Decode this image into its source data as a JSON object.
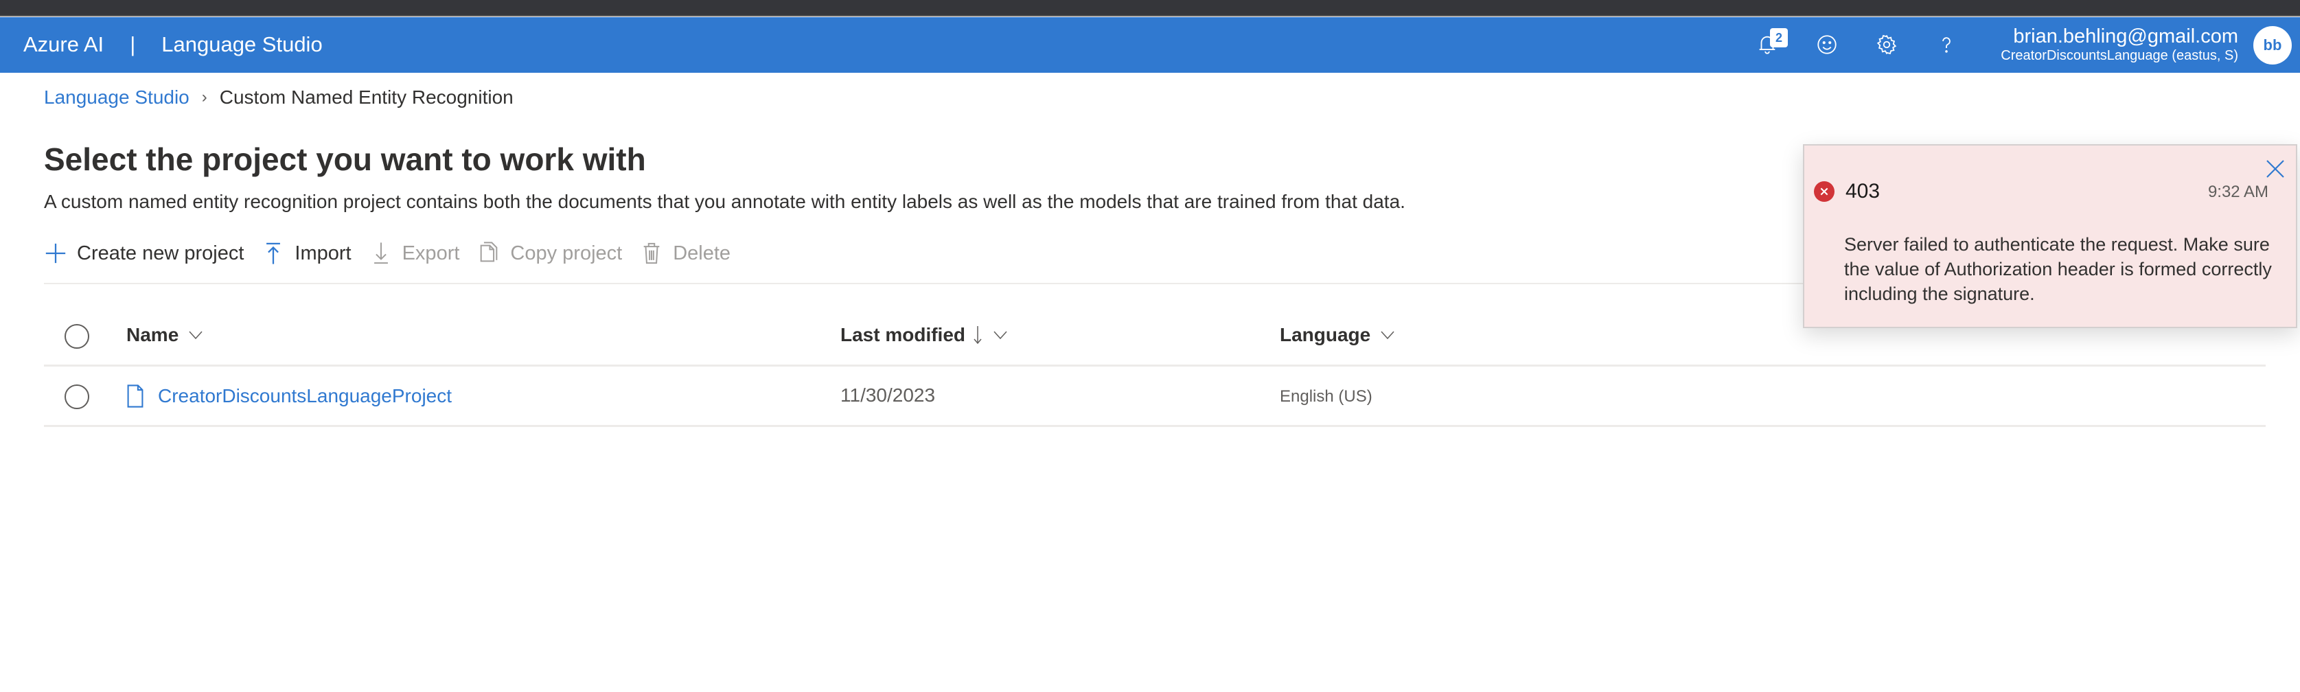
{
  "header": {
    "brand": "Azure AI",
    "separator": "|",
    "product": "Language Studio",
    "notifications_count": "2",
    "icons": [
      "bell-icon",
      "feedback-smiley-icon",
      "gear-icon",
      "help-icon"
    ],
    "account_email": "brian.behling@gmail.com",
    "account_resource": "CreatorDiscountsLanguage (eastus, S)",
    "avatar_initials": "bb",
    "color": "#3079d0"
  },
  "breadcrumb": {
    "items": [
      {
        "label": "Language Studio"
      },
      {
        "label": "Custom Named Entity Recognition"
      }
    ]
  },
  "page": {
    "title": "Select the project you want to work with",
    "description": "A custom named entity recognition project contains both the documents that you annotate with entity labels as well as the models that are trained from that data."
  },
  "toolbar": {
    "create_label": "Create new project",
    "import_label": "Import",
    "export_label": "Export",
    "copy_label": "Copy project",
    "delete_label": "Delete"
  },
  "table": {
    "columns": {
      "name": "Name",
      "last_modified": "Last modified",
      "language": "Language"
    },
    "sort": {
      "column": "last_modified",
      "direction": "descending"
    },
    "rows": [
      {
        "name": "CreatorDiscountsLanguageProject",
        "last_modified": "11/30/2023",
        "language": "English (US)"
      }
    ]
  },
  "toast": {
    "status": "error",
    "code": "403",
    "time": "9:32 AM",
    "message": "Server failed to authenticate the request. Make sure the value of Authorization header is formed correctly including the signature.",
    "error_color": "#d13438"
  }
}
